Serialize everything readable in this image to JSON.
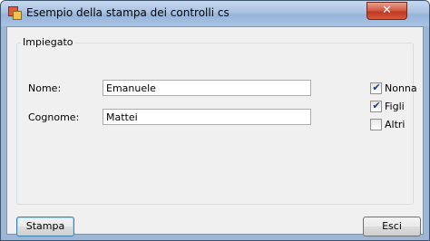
{
  "window": {
    "title": "Esempio della stampa dei controlli cs",
    "close_glyph": "✕"
  },
  "group": {
    "label": "Impiegato"
  },
  "fields": [
    {
      "label": "Nome:",
      "value": "Emanuele"
    },
    {
      "label": "Cognome:",
      "value": "Mattei"
    }
  ],
  "checkboxes": [
    {
      "label": "Nonna",
      "checked": true,
      "mark": "✔"
    },
    {
      "label": "Figli",
      "checked": true,
      "mark": "✔"
    },
    {
      "label": "Altri",
      "checked": false,
      "mark": ""
    }
  ],
  "buttons": {
    "print": "Stampa",
    "exit": "Esci"
  },
  "colors": {
    "titlebar": "#a9c2e2",
    "client": "#f0f0f0",
    "close": "#c0361f"
  }
}
